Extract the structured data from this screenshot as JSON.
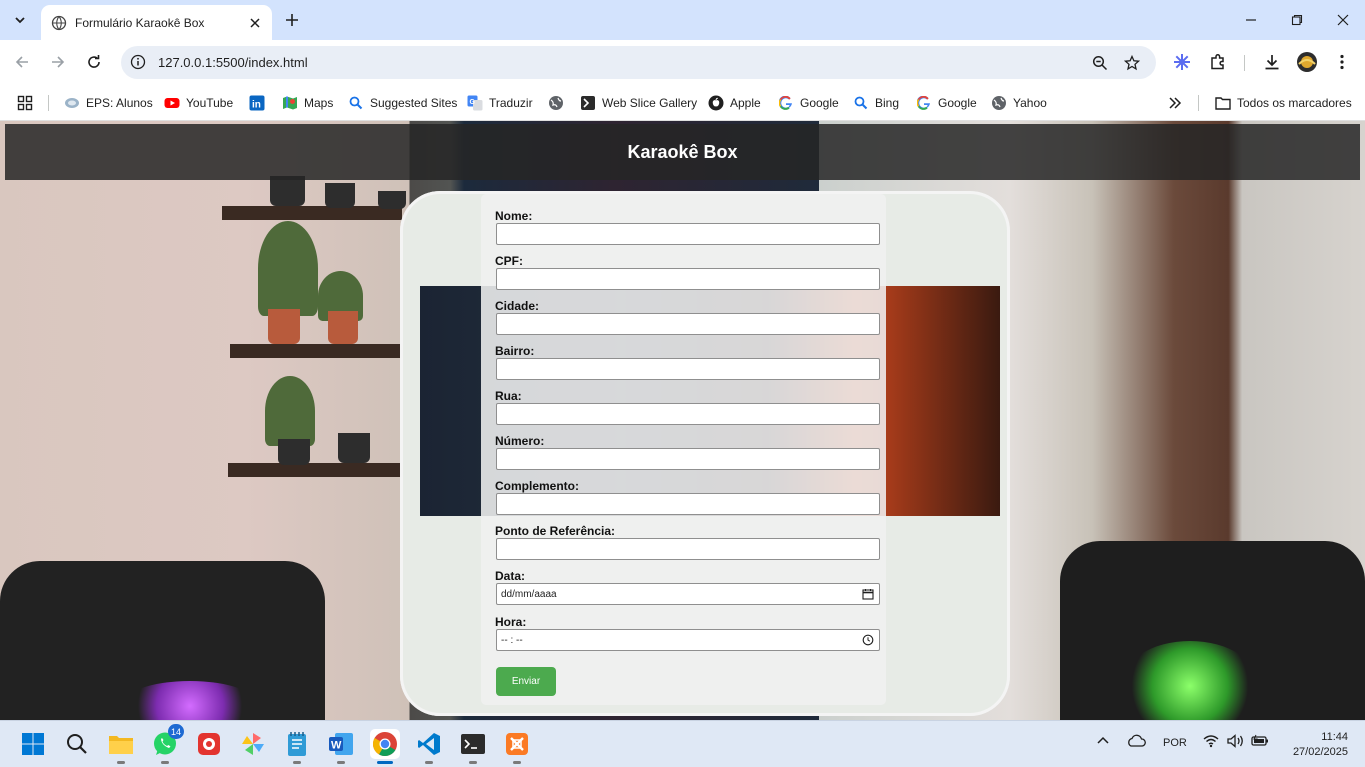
{
  "browser": {
    "tab_title": "Formulário Karaokê Box",
    "url": "127.0.0.1:5500/index.html",
    "bookmarks": [
      {
        "label": "EPS: Alunos",
        "icon": "eps-icon"
      },
      {
        "label": "YouTube",
        "icon": "youtube-icon"
      },
      {
        "label": "",
        "icon": "linkedin-icon"
      },
      {
        "label": "Maps",
        "icon": "maps-icon"
      },
      {
        "label": "Suggested Sites",
        "icon": "search-icon"
      },
      {
        "label": "Traduzir",
        "icon": "translate-icon"
      },
      {
        "label": "",
        "icon": "globe-icon"
      },
      {
        "label": "Web Slice Gallery",
        "icon": "web-slice-icon"
      },
      {
        "label": "Apple",
        "icon": "apple-icon"
      },
      {
        "label": "Google",
        "icon": "google-icon"
      },
      {
        "label": "Bing",
        "icon": "bing-search-icon"
      },
      {
        "label": "Google",
        "icon": "google-icon"
      },
      {
        "label": "Yahoo",
        "icon": "globe-icon"
      }
    ],
    "all_bookmarks": "Todos os marcadores"
  },
  "page": {
    "header_title": "Karaokê Box",
    "fields": [
      {
        "label": "Nome:"
      },
      {
        "label": "CPF:"
      },
      {
        "label": "Cidade:"
      },
      {
        "label": "Bairro:"
      },
      {
        "label": "Rua:"
      },
      {
        "label": "Número:"
      },
      {
        "label": "Complemento:"
      },
      {
        "label": "Ponto de Referência:"
      }
    ],
    "date_label": "Data:",
    "date_placeholder": "dd/mm/aaaa",
    "time_label": "Hora:",
    "time_placeholder": "-- : --",
    "submit_label": "Enviar"
  },
  "taskbar": {
    "whatsapp_badge": "14",
    "language": "POR",
    "time": "11:44",
    "date": "27/02/2025"
  },
  "colors": {
    "tabstrip": "#d3e3fd",
    "submit": "#4caa4e",
    "header_bg": "#262626"
  }
}
